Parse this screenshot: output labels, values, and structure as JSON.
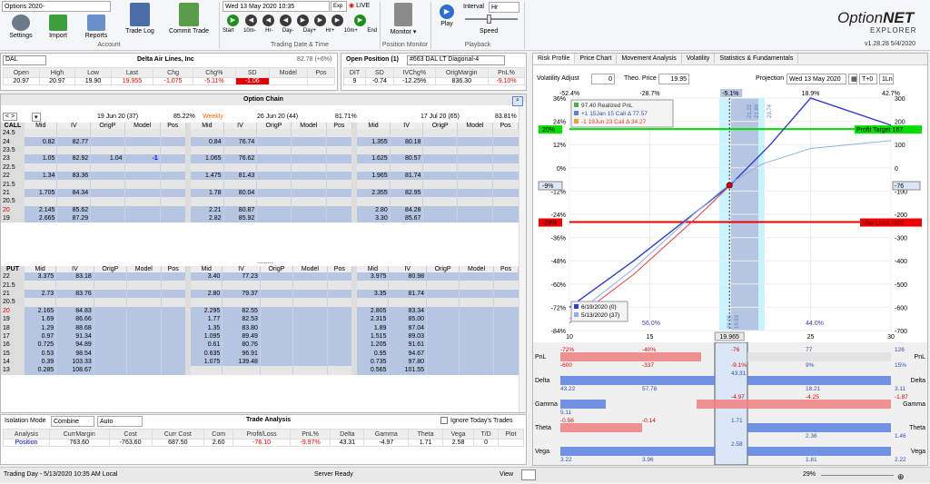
{
  "title_combo": "Options 2020-",
  "toolbar": {
    "settings": "Settings",
    "import": "Import",
    "reports": "Reports",
    "trade_log": "Trade Log",
    "commit_trade": "Commit Trade",
    "account_group": "Account",
    "date_value": "Wed 13 May  2020 10:35",
    "exp": "Exp",
    "live": "LIVE",
    "start": "Start",
    "ten_m_minus": "10m-",
    "hr_minus": "Hr-",
    "day_minus": "Day-",
    "day_plus": "Day+",
    "hr_plus": "Hr+",
    "ten_m_plus": "10m+",
    "end": "End",
    "trading_group": "Trading Date & Time",
    "monitor": "Monitor",
    "position_group": "Position Monitor",
    "play": "Play",
    "interval_label": "Interval",
    "interval_value": "Hr",
    "speed": "Speed",
    "playback_group": "Playback"
  },
  "brand": {
    "name_a": "Option",
    "name_b": "NET",
    "sub": "EXPLORER",
    "version": "v1.28.28  5/4/2020"
  },
  "quote": {
    "symbol": "DAL",
    "company": "Delta Air Lines, Inc",
    "iv_text": "82.78 (+6%)",
    "headers": [
      "Open",
      "High",
      "Low",
      "Last",
      "Chg",
      "Chg%",
      "SD",
      "Model",
      "Pos"
    ],
    "values": [
      "20.97",
      "20.97",
      "19.90",
      "19.955",
      "-1.075",
      "-5.11%",
      "-1.06",
      "",
      ""
    ]
  },
  "open_position": {
    "label": "Open Position (1)",
    "name": "#663 DAL LT Diagonal-4",
    "headers": [
      "DIT",
      "SD",
      "IVChg%",
      "OrigMargin",
      "PnL%"
    ],
    "values": [
      "9",
      "-0.74",
      "-12.25%",
      "836.30",
      "-9.10%"
    ]
  },
  "option_chain": {
    "title": "Option Chain",
    "exp1": "19 Jun 20 (37)",
    "exp1_pct": "85.22%",
    "weekly": "Weekly",
    "exp2": "26 Jun 20 (44)",
    "exp2_pct": "81.71%",
    "exp3": "17 Jul 20 (65)",
    "exp3_pct": "83.81%",
    "call_label": "CALL",
    "put_label": "PUT",
    "col_headers": [
      "Mid",
      "IV",
      "OrigP",
      "Model",
      "Pos"
    ],
    "calls": [
      [
        "24.5",
        "",
        "",
        "",
        "",
        "",
        "",
        "",
        "",
        "",
        "",
        "",
        "",
        ""
      ],
      [
        "24",
        "0.82",
        "82.77",
        "",
        "",
        "0.84",
        "76.74",
        "",
        "",
        "1.355",
        "80.18",
        "",
        "",
        ""
      ],
      [
        "23.5",
        "",
        "",
        "",
        "",
        "",
        "",
        "",
        "",
        "",
        "",
        "",
        "",
        ""
      ],
      [
        "23",
        "1.05",
        "82.92",
        "1.04",
        "-1",
        "1.065",
        "76.62",
        "",
        "",
        "1.625",
        "80.57",
        "",
        "",
        ""
      ],
      [
        "22.5",
        "",
        "",
        "",
        "",
        "",
        "",
        "",
        "",
        "",
        "",
        "",
        "",
        ""
      ],
      [
        "22",
        "1.34",
        "83.36",
        "",
        "",
        "1.475",
        "81.43",
        "",
        "",
        "1.965",
        "81.74",
        "",
        "",
        ""
      ],
      [
        "21.5",
        "",
        "",
        "",
        "",
        "",
        "",
        "",
        "",
        "",
        "",
        "",
        "",
        ""
      ],
      [
        "21",
        "1.705",
        "84.34",
        "",
        "",
        "1.78",
        "80.04",
        "",
        "",
        "2.355",
        "82.95",
        "",
        "",
        ""
      ],
      [
        "20.5",
        "",
        "",
        "",
        "",
        "",
        "",
        "",
        "",
        "",
        "",
        "",
        "",
        ""
      ],
      [
        "20",
        "2.145",
        "85.62",
        "",
        "",
        "2.21",
        "80.87",
        "",
        "",
        "2.80",
        "84.28",
        "",
        "",
        ""
      ],
      [
        "19",
        "2.665",
        "87.29",
        "",
        "",
        "2.82",
        "85.92",
        "",
        "",
        "3.30",
        "85.67",
        "",
        "",
        ""
      ]
    ],
    "puts": [
      [
        "22",
        "3.375",
        "83.18",
        "",
        "",
        "3.40",
        "77.23",
        "",
        "",
        "3.975",
        "80.98",
        "",
        "",
        ""
      ],
      [
        "21.5",
        "",
        "",
        "",
        "",
        "",
        "",
        "",
        "",
        "",
        "",
        "",
        "",
        ""
      ],
      [
        "21",
        "2.73",
        "83.76",
        "",
        "",
        "2.80",
        "79.37",
        "",
        "",
        "3.35",
        "81.74",
        "",
        "",
        ""
      ],
      [
        "20.5",
        "",
        "",
        "",
        "",
        "",
        "",
        "",
        "",
        "",
        "",
        "",
        "",
        ""
      ],
      [
        "20",
        "2.165",
        "84.83",
        "",
        "",
        "2.295",
        "82.55",
        "",
        "",
        "2.805",
        "83.34",
        "",
        "",
        ""
      ],
      [
        "19",
        "1.69",
        "86.66",
        "",
        "",
        "1.77",
        "82.53",
        "",
        "",
        "2.315",
        "85.00",
        "",
        "",
        ""
      ],
      [
        "18",
        "1.29",
        "88.68",
        "",
        "",
        "1.35",
        "83.80",
        "",
        "",
        "1.89",
        "87.04",
        "",
        "",
        ""
      ],
      [
        "17",
        "0.97",
        "91.34",
        "",
        "",
        "1.095",
        "89.49",
        "",
        "",
        "1.515",
        "89.03",
        "",
        "",
        ""
      ],
      [
        "16",
        "0.725",
        "94.89",
        "",
        "",
        "0.61",
        "80.76",
        "",
        "",
        "1.205",
        "91.61",
        "",
        "",
        ""
      ],
      [
        "15",
        "0.53",
        "98.54",
        "",
        "",
        "0.635",
        "96.91",
        "",
        "",
        "0.95",
        "94.67",
        "",
        "",
        ""
      ],
      [
        "14",
        "0.39",
        "103.33",
        "",
        "",
        "1.075",
        "139.48",
        "",
        "",
        "0.735",
        "97.80",
        "",
        "",
        ""
      ],
      [
        "13",
        "0.285",
        "108.67",
        "",
        "",
        "",
        "",
        "",
        "",
        "0.565",
        "101.55",
        "",
        "",
        ""
      ]
    ]
  },
  "trade_analysis": {
    "title": "Trade Analysis",
    "isolation_label": "Isolation Mode",
    "isolation_value": "Combine",
    "auto_value": "Auto",
    "ignore_label": "Ignore Today's Trades",
    "headers": [
      "Analysis",
      "CurrMargin",
      "Cost",
      "Curr Cost",
      "Com",
      "Profit/Loss",
      "PnL%",
      "Delta",
      "Gamma",
      "Theta",
      "Vega",
      "T/D",
      "Plot"
    ],
    "values": [
      "Position",
      "763.60",
      "-763.60",
      "687.50",
      "2.60",
      "-76.10",
      "-9.97%",
      "43.31",
      "-4.97",
      "1.71",
      "2.58",
      "0",
      ""
    ]
  },
  "risk": {
    "tabs": [
      "Risk Profile",
      "Price Chart",
      "Movement Analysis",
      "Volatility",
      "Statistics & Fundamentals"
    ],
    "vol_adjust": "Volatility Adjust",
    "vol_value": "0",
    "theo_label": "Theo. Price",
    "theo_value": "19.95",
    "projection_label": "Projection",
    "projection_value": "Wed 13 May  2020",
    "t0": "T+0",
    "one_ln": "1Ln",
    "top_ticks": [
      "-52.4%",
      "-28.7%",
      "-5.1%",
      "18.9%",
      "42.7%"
    ],
    "left_ticks": [
      "36%",
      "24%",
      "12%",
      "0%",
      "-12%",
      "-24%",
      "-36%",
      "-48%",
      "-60%",
      "-72%",
      "-84%"
    ],
    "right_ticks": [
      "300",
      "200",
      "100",
      "0",
      "-100",
      "-200",
      "-300",
      "-400",
      "-500",
      "-600",
      "-700"
    ],
    "x_ticks": [
      "10",
      "15",
      "20",
      "25",
      "30"
    ],
    "profit_target": "Profit Target 167",
    "max_loss": "Max Loss -209",
    "pt_left": "20%",
    "ml_left": "-28%",
    "neg9": "-9%",
    "neg76": "-76",
    "legend": [
      "97.40 Realized PnL",
      "+1 15Jan 15 Call Δ   77.57",
      "-1 19Jun 23 Call Δ   34.27"
    ],
    "dates": [
      "6/19/2020 (0)",
      "5/13/2020 (37)"
    ],
    "pct_left": "56.0%",
    "pct_right": "44.0%",
    "x_marker": "19.965",
    "band_labels": [
      "20.06",
      "19.93",
      "21.22",
      "21.89",
      "23.74"
    ]
  },
  "greeks": {
    "rows": [
      {
        "name": "PnL",
        "left_top": "-72%",
        "left_bot": "-600",
        "mid_top": "-40%",
        "mid_bot": "-337",
        "center_top": "-76",
        "center_bot": "-9.1%",
        "r1_top": "77",
        "r1_bot": "9%",
        "r2_top": "126",
        "r2_bot": "15%"
      },
      {
        "name": "Delta",
        "left_top": "",
        "left_bot": "43.22",
        "mid_top": "",
        "mid_bot": "57.78",
        "center_top": "43.31",
        "center_bot": "",
        "r1_top": "",
        "r1_bot": "18.21",
        "r2_top": "",
        "r2_bot": "3.11"
      },
      {
        "name": "Gamma",
        "left_top": "",
        "left_bot": "5.11",
        "mid_top": "",
        "mid_bot": "",
        "center_top": "-4.97",
        "center_bot": "",
        "r1_top": "-4.25",
        "r1_bot": "",
        "r2_top": "-1.87",
        "r2_bot": ""
      },
      {
        "name": "Theta",
        "left_top": "-0.56",
        "left_bot": "",
        "mid_top": "-0.14",
        "mid_bot": "",
        "center_top": "1.71",
        "center_bot": "",
        "r1_top": "",
        "r1_bot": "2.36",
        "r2_top": "",
        "r2_bot": "1.46"
      },
      {
        "name": "Vega",
        "left_top": "",
        "left_bot": "3.22",
        "mid_top": "",
        "mid_bot": "3.96",
        "center_top": "2.58",
        "center_bot": "",
        "r1_top": "",
        "r1_bot": "1.81",
        "r2_top": "",
        "r2_bot": "2.22"
      }
    ]
  },
  "status": {
    "left": "Trading Day - 5/13/2020 10:35 AM Local",
    "server": "Server Ready",
    "view": "View",
    "zoom": "29%"
  },
  "colors": {
    "blue_cell": "#b6c5e1",
    "negative": "#e00000",
    "profit": "#00dd00",
    "loss": "#ee0000"
  }
}
